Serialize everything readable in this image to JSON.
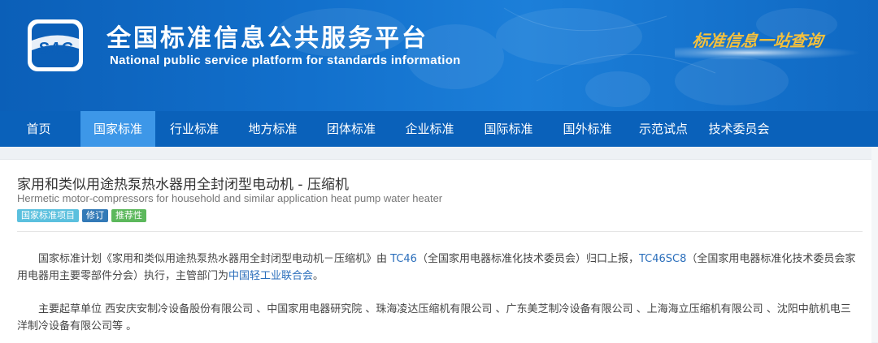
{
  "header": {
    "logo_text": "SAC",
    "title": "全国标准信息公共服务平台",
    "subtitle": "National public service platform  for standards information",
    "slogan": "标准信息一站查询"
  },
  "nav": {
    "items": [
      {
        "label": "首页",
        "active": false
      },
      {
        "label": "国家标准",
        "active": true
      },
      {
        "label": "行业标准",
        "active": false
      },
      {
        "label": "地方标准",
        "active": false
      },
      {
        "label": "团体标准",
        "active": false
      },
      {
        "label": "企业标准",
        "active": false
      },
      {
        "label": "国际标准",
        "active": false
      },
      {
        "label": "国外标准",
        "active": false
      },
      {
        "label": "示范试点",
        "active": false
      },
      {
        "label": "技术委员会",
        "active": false
      }
    ]
  },
  "standard": {
    "title_cn": "家用和类似用途热泵热水器用全封闭型电动机 - 压缩机",
    "title_en": "Hermetic motor-compressors for household and similar application heat pump water heater",
    "badges": [
      "国家标准项目",
      "修订",
      "推荐性"
    ],
    "para1": {
      "t1": "国家标准计划《家用和类似用途热泵热水器用全封闭型电动机－压缩机》由 ",
      "link1": "TC46",
      "t2": "（全国家用电器标准化技术委员会）归口上报，",
      "link2": "TC46SC8",
      "t3": "（全国家用电器标准化技术委员会家用电器用主要零部件分会）执行，主管部门为",
      "link3": "中国轻工业联合会",
      "t4": "。"
    },
    "para2": {
      "text": "主要起草单位 西安庆安制冷设备股份有限公司 、中国家用电器研究院 、珠海凌达压缩机有限公司 、广东美芝制冷设备有限公司 、上海海立压缩机有限公司 、沈阳中航机电三洋制冷设备有限公司等 。"
    }
  },
  "colors": {
    "banner": "#1270cc",
    "nav": "#0a61ba",
    "nav_active": "#3d97e8",
    "slogan": "#f6c13c",
    "link": "#2a6ebb"
  }
}
